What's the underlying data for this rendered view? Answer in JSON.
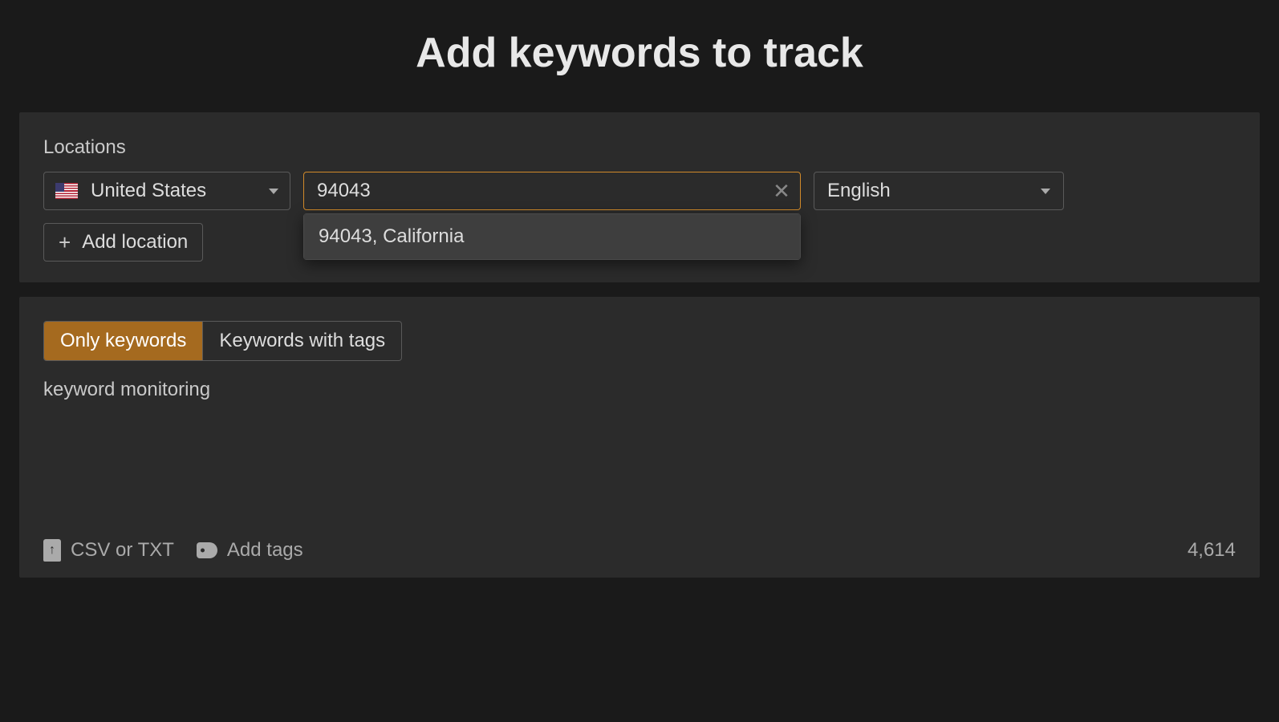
{
  "title": "Add keywords to track",
  "locations": {
    "label": "Locations",
    "country": "United States",
    "search_value": "94043",
    "suggestion": "94043, California",
    "language": "English",
    "add_button": "Add location"
  },
  "tabs": {
    "only_keywords": "Only keywords",
    "keywords_with_tags": "Keywords with tags"
  },
  "keywords_text": "keyword monitoring",
  "footer": {
    "upload_label": "CSV or TXT",
    "tags_label": "Add tags",
    "count": "4,614"
  }
}
